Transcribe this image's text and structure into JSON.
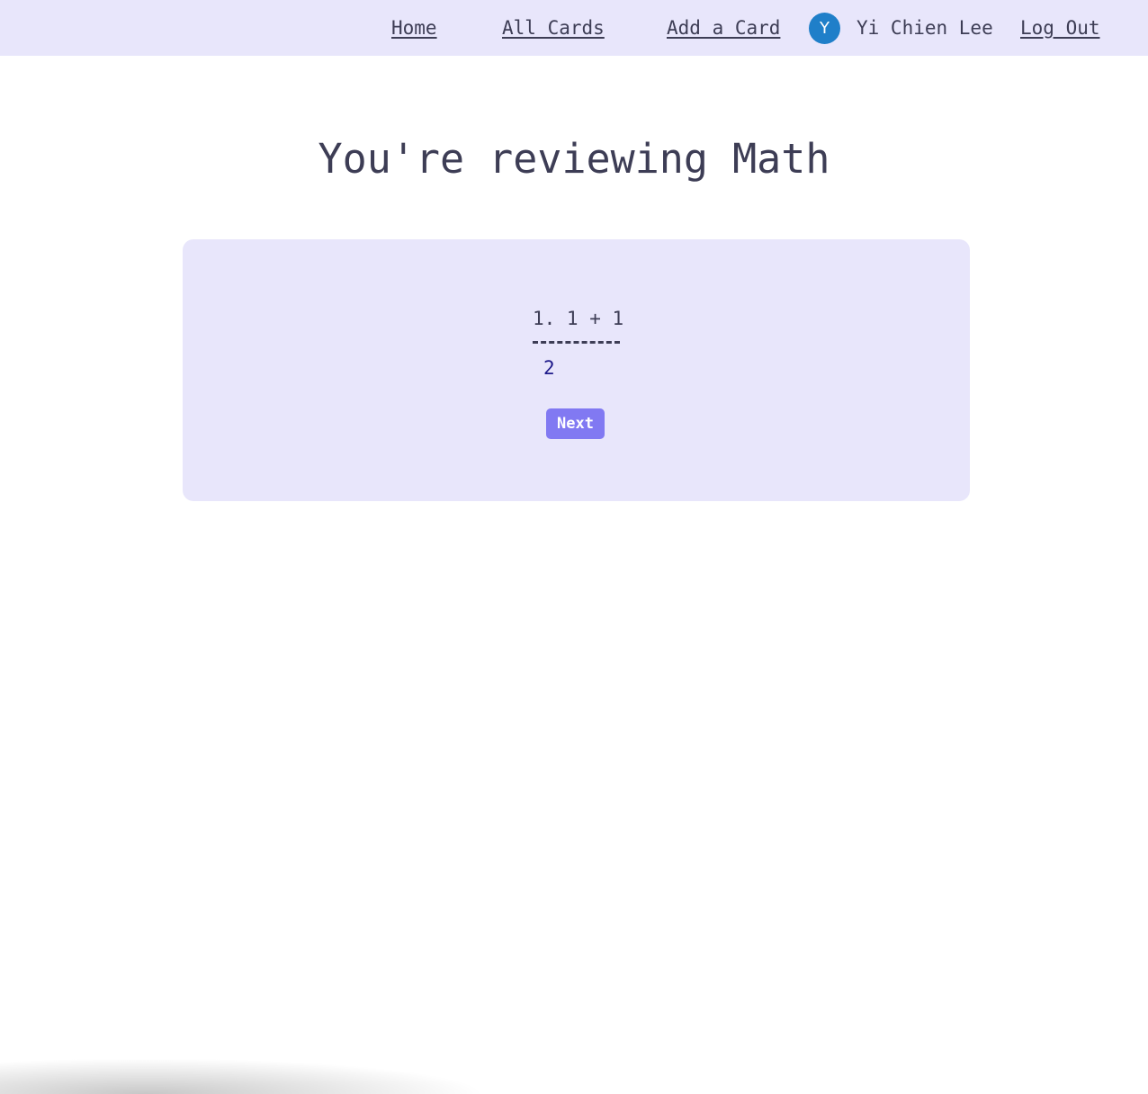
{
  "nav": {
    "home_label": "Home",
    "all_cards_label": "All Cards",
    "add_card_label": "Add a Card",
    "user": {
      "avatar_initial": "Y",
      "avatar_color": "#1f7fc9",
      "name": "Yi Chien Lee"
    },
    "logout_label": "Log Out"
  },
  "main": {
    "title": "You're reviewing Math",
    "card": {
      "question": "1. 1 + 1",
      "answer": "2",
      "next_label": "Next"
    }
  },
  "colors": {
    "nav_background": "#e8e6fb",
    "card_background": "#e8e6fb",
    "button_accent": "#8179f2",
    "text": "#3d3d55",
    "answer_text": "#1e1a8a"
  }
}
